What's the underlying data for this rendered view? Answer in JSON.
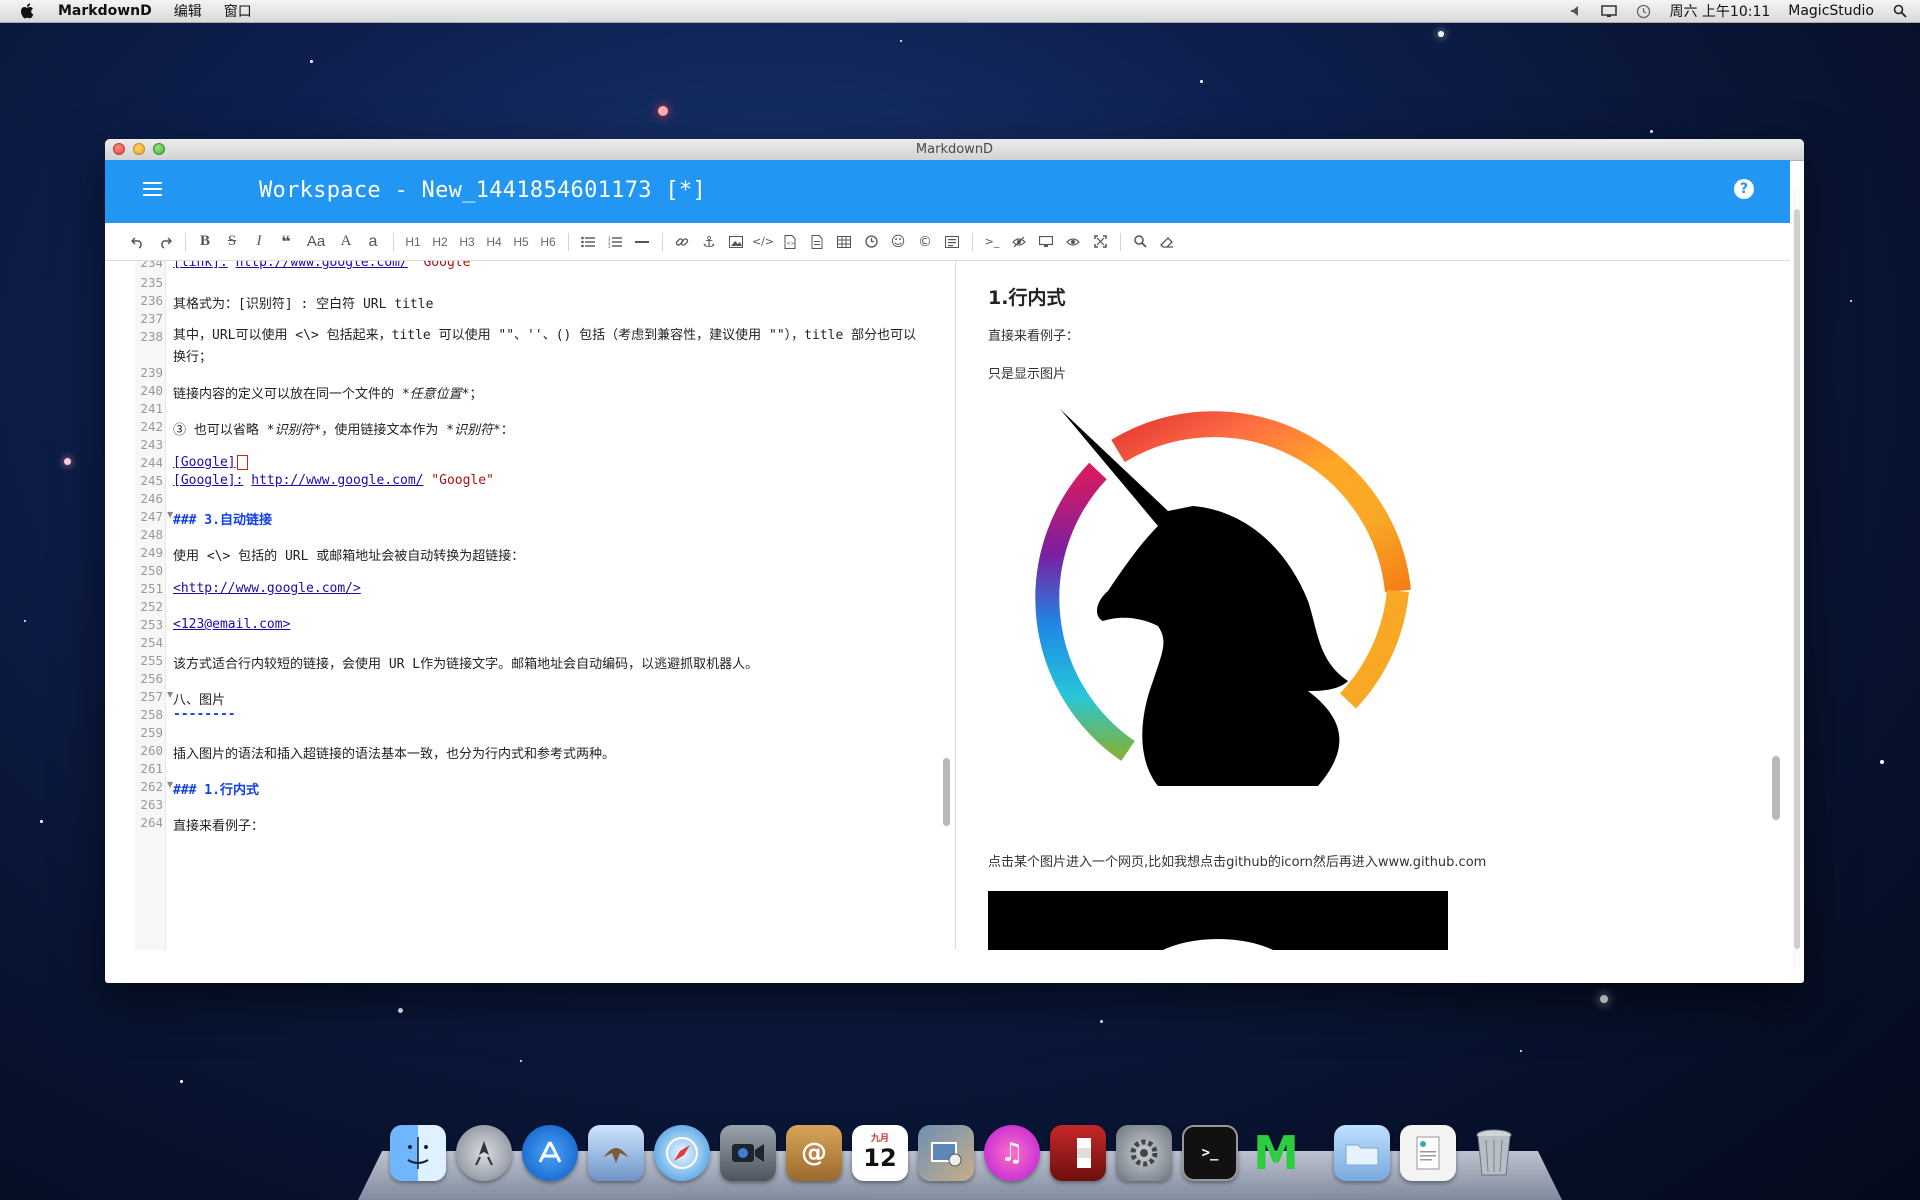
{
  "menubar": {
    "app_name": "MarkdownD",
    "menus": [
      "编辑",
      "窗口"
    ],
    "clock": "周六 上午10:11",
    "user": "MagicStudio"
  },
  "window": {
    "title": "MarkdownD",
    "workspace_title": "Workspace - New_1441854601173 [*]",
    "help_label": "?"
  },
  "toolbar": {
    "headings": [
      "H1",
      "H2",
      "H3",
      "H4",
      "H5",
      "H6"
    ],
    "font_case": "Aa",
    "font_size": "A",
    "font_case_lower": "a"
  },
  "editor": {
    "lines": [
      {
        "n": "234",
        "text": ""
      },
      {
        "n": "235",
        "text": ""
      },
      {
        "n": "236",
        "text": "其格式为：[识别符] : 空白符 URL title"
      },
      {
        "n": "237",
        "text": ""
      },
      {
        "n": "238",
        "text": "其中，URL可以使用 <\\> 包括起来，title 可以使用 \"\"、''、() 包括（考虑到兼容性，建议使用 \"\"），title 部分也可以换行；"
      },
      {
        "n": "239",
        "text": ""
      },
      {
        "n": "240",
        "text": "链接内容的定义可以放在同一个文件的 "
      },
      {
        "n": "241",
        "text": ""
      },
      {
        "n": "242",
        "text": "③ 也可以省略 "
      },
      {
        "n": "243",
        "text": ""
      },
      {
        "n": "244",
        "text": ""
      },
      {
        "n": "245",
        "text": ""
      },
      {
        "n": "246",
        "text": ""
      },
      {
        "n": "247",
        "text": ""
      },
      {
        "n": "248",
        "text": ""
      },
      {
        "n": "249",
        "text": "使用 <\\> 包括的 URL 或邮箱地址会被自动转换为超链接："
      },
      {
        "n": "250",
        "text": ""
      },
      {
        "n": "251",
        "text": ""
      },
      {
        "n": "252",
        "text": ""
      },
      {
        "n": "253",
        "text": ""
      },
      {
        "n": "254",
        "text": ""
      },
      {
        "n": "255",
        "text": "该方式适合行内较短的链接，会使用 UR L作为链接文字。邮箱地址会自动编码，以逃避抓取机器人。"
      },
      {
        "n": "256",
        "text": ""
      },
      {
        "n": "257",
        "text": "八、图片"
      },
      {
        "n": "258",
        "text": ""
      },
      {
        "n": "259",
        "text": ""
      },
      {
        "n": "260",
        "text": "插入图片的语法和插入超链接的语法基本一致，也分为行内式和参考式两种。"
      },
      {
        "n": "261",
        "text": ""
      },
      {
        "n": "262",
        "text": ""
      },
      {
        "n": "263",
        "text": ""
      },
      {
        "n": "264",
        "text": "直接来看例子："
      }
    ],
    "line234_ref": "[link]:",
    "line234_url": "http://www.google.com/",
    "line234_title": "\"Google\"",
    "line240_em": "*任意位置*",
    "line240_tail": "；",
    "line242_em1": "*识别符*",
    "line242_mid": "，使用链接文本作为 ",
    "line242_em2": "*识别符*",
    "line242_tail": "：",
    "line244_ref": "[Google]",
    "line244_empty": "[]",
    "line245_ref": "[Google]:",
    "line245_url": "http://www.google.com/",
    "line245_title": "\"Google\"",
    "line247_hdr": "### 3.自动链接",
    "line251_link": "<http://www.google.com/>",
    "line253_link": "<123@email.com>",
    "line258_rule": "--------",
    "line262_hdr": "### 1.行内式"
  },
  "preview": {
    "heading": "1.行内式",
    "p1": "直接来看例子：",
    "p2": "只是显示图片",
    "p3": "点击某个图片进入一个网页,比如我想点击github的icorn然后再进入www.github.com"
  },
  "dock": {
    "calendar_month": "九月",
    "calendar_day": "12",
    "apps": [
      "finder",
      "launchpad",
      "app-store",
      "mail",
      "safari",
      "facetime",
      "contacts",
      "calendar",
      "photos",
      "itunes",
      "photo-booth",
      "system-preferences",
      "terminal",
      "markdownd",
      "downloads",
      "documents",
      "trash"
    ]
  }
}
